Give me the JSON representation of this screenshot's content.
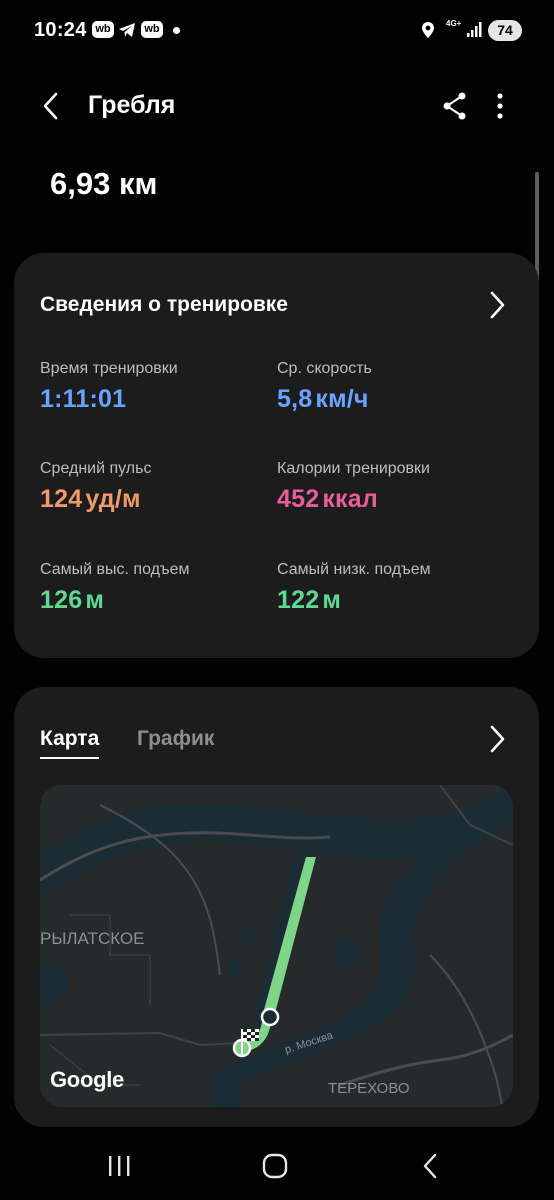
{
  "status_bar": {
    "time": "10:24",
    "wb_badge": "wb",
    "network": "4G+",
    "battery": "74"
  },
  "header": {
    "title": "Гребля",
    "back_icon": "back-arrow-icon",
    "share_icon": "share-icon",
    "more_icon": "more-vertical-icon"
  },
  "summary": {
    "distance": "6,93 км"
  },
  "workout_details": {
    "title": "Сведения о тренировке",
    "stats": [
      {
        "label": "Время тренировки",
        "value": "1:11:01",
        "unit": "",
        "color": "#6aa2ff"
      },
      {
        "label": "Ср. скорость",
        "value": "5,8",
        "unit": "км/ч",
        "color": "#6aa2ff"
      },
      {
        "label": "Средний пульс",
        "value": "124",
        "unit": "уд/м",
        "color": "#ee9a6c"
      },
      {
        "label": "Калории тренировки",
        "value": "452",
        "unit": "ккал",
        "color": "#ea5c9b"
      },
      {
        "label": "Самый выс. подъем",
        "value": "126",
        "unit": "м",
        "color": "#5fd891"
      },
      {
        "label": "Самый низк. подъем",
        "value": "122",
        "unit": "м",
        "color": "#5fd891"
      }
    ]
  },
  "map_section": {
    "tabs": [
      {
        "label": "Карта",
        "active": true
      },
      {
        "label": "График",
        "active": false
      }
    ],
    "labels": {
      "district": "РЫЛАТСКОЕ",
      "river": "р. Москва",
      "village": "ТЕРЕХОВО",
      "attribution": "Google"
    },
    "route_color": "#7ed487"
  },
  "nav_bar": {
    "recents_icon": "recents-icon",
    "home_icon": "home-icon",
    "back_icon": "back-icon"
  }
}
